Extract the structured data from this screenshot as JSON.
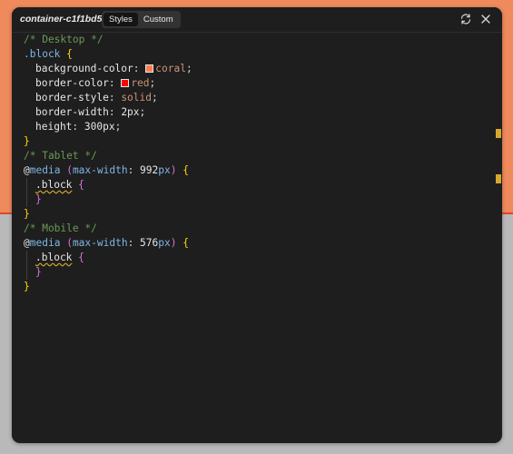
{
  "window": {
    "title": "container-c1f1bd5",
    "tabs": [
      "Styles",
      "Custom"
    ],
    "active_tab": "Styles"
  },
  "icons": [
    "refresh-icon",
    "close-icon"
  ],
  "code": {
    "comment_desktop": "/* Desktop */",
    "selector_block": ".block",
    "open_brace": "{",
    "close_brace": "}",
    "props": [
      {
        "name": "background-color",
        "value": "coral",
        "swatch": "#ff7f50"
      },
      {
        "name": "border-color",
        "value": "red",
        "swatch": "#ff0000"
      },
      {
        "name": "border-style",
        "value": "solid"
      },
      {
        "name": "border-width",
        "value": "2px"
      },
      {
        "name": "height",
        "value": "300px"
      }
    ],
    "comment_tablet": "/* Tablet */",
    "comment_mobile": "/* Mobile */",
    "at": "@",
    "media_kw": "media",
    "media_feature": "max-width",
    "tablet_num": "992",
    "mobile_num": "576",
    "unit": "px"
  },
  "colors": {
    "background_top": "#ef8a5d",
    "background_bottom": "#b9b9b9",
    "panel": "#1e1e1e",
    "marker": "#d7a82a"
  }
}
